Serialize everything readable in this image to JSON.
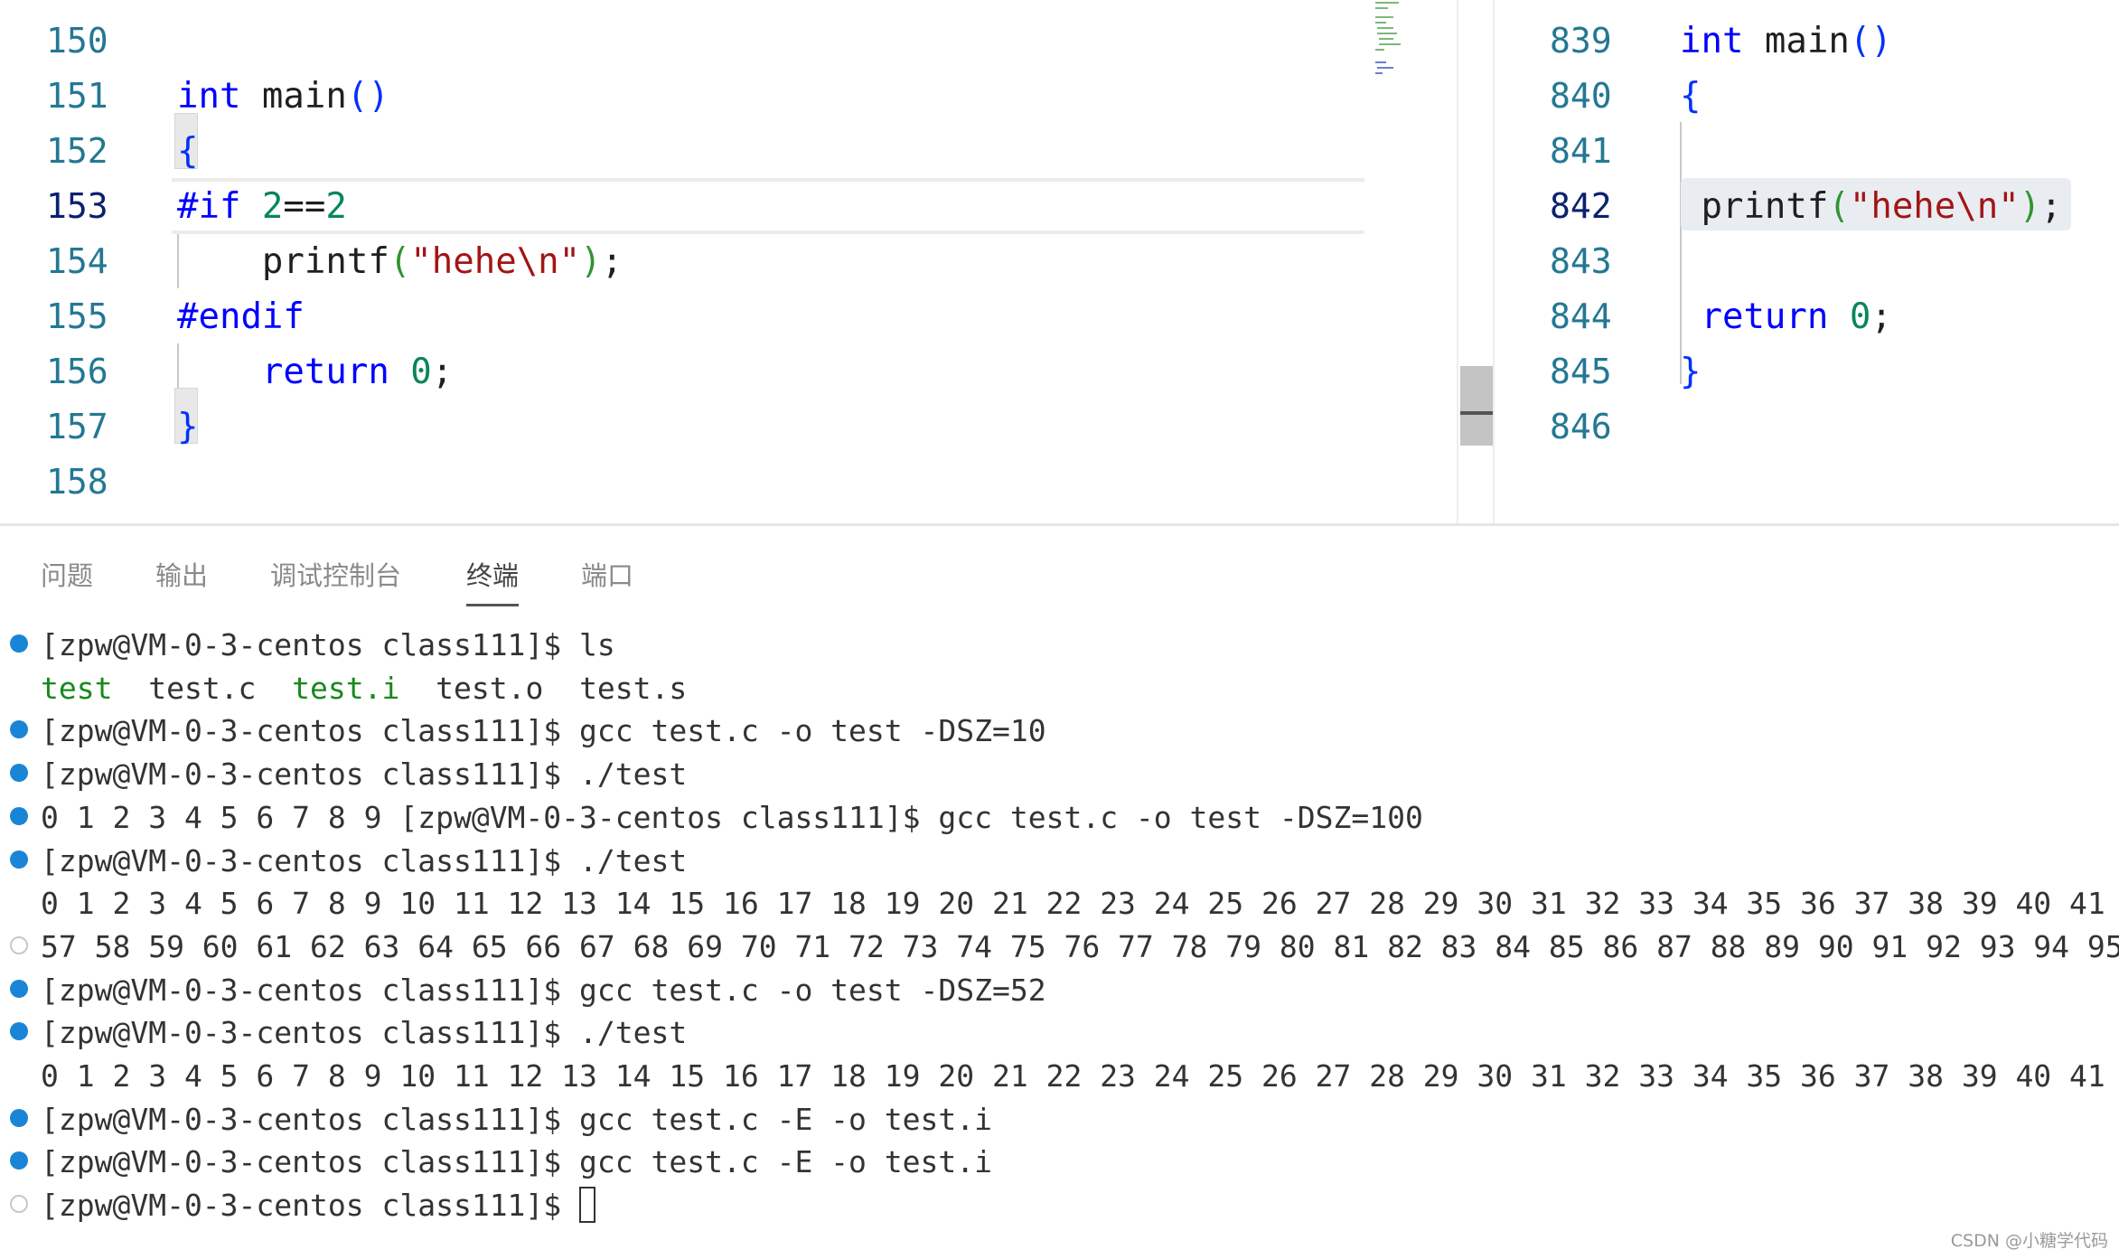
{
  "colors": {
    "keyword": "#0000ff",
    "string": "#a31515",
    "number": "#098658",
    "line_number": "#237893",
    "terminal_dot": "#1a85d6",
    "ls_executable": "#18891d"
  },
  "left_editor": {
    "lines": [
      {
        "num": "150",
        "tokens": []
      },
      {
        "num": "151",
        "tokens": [
          {
            "t": "int",
            "c": "kw"
          },
          {
            "t": " main",
            "c": "txt"
          },
          {
            "t": "()",
            "c": "br1"
          }
        ]
      },
      {
        "num": "152",
        "tokens": [
          {
            "t": "{",
            "c": "br1"
          }
        ]
      },
      {
        "num": "153",
        "current": true,
        "tokens": [
          {
            "t": "#if ",
            "c": "pp"
          },
          {
            "t": "2",
            "c": "num"
          },
          {
            "t": "==",
            "c": "txt"
          },
          {
            "t": "2",
            "c": "num"
          }
        ]
      },
      {
        "num": "154",
        "tokens": [
          {
            "t": "    printf",
            "c": "txt"
          },
          {
            "t": "(",
            "c": "br2"
          },
          {
            "t": "\"hehe\\n\"",
            "c": "str"
          },
          {
            "t": ")",
            "c": "br2"
          },
          {
            "t": ";",
            "c": "txt"
          }
        ]
      },
      {
        "num": "155",
        "tokens": [
          {
            "t": "#endif",
            "c": "pp"
          }
        ]
      },
      {
        "num": "156",
        "tokens": [
          {
            "t": "    return ",
            "c": "kw"
          },
          {
            "t": "0",
            "c": "num"
          },
          {
            "t": ";",
            "c": "txt"
          }
        ]
      },
      {
        "num": "157",
        "tokens": [
          {
            "t": "}",
            "c": "br1"
          }
        ]
      },
      {
        "num": "158",
        "tokens": []
      }
    ]
  },
  "right_editor": {
    "lines": [
      {
        "num": "839",
        "tokens": [
          {
            "t": "int",
            "c": "kw"
          },
          {
            "t": " main",
            "c": "txt"
          },
          {
            "t": "()",
            "c": "br1"
          }
        ]
      },
      {
        "num": "840",
        "tokens": [
          {
            "t": "{",
            "c": "br1"
          }
        ]
      },
      {
        "num": "841",
        "tokens": []
      },
      {
        "num": "842",
        "current": true,
        "tokens": [
          {
            "t": " printf",
            "c": "txt"
          },
          {
            "t": "(",
            "c": "br2"
          },
          {
            "t": "\"hehe\\n\"",
            "c": "str"
          },
          {
            "t": ")",
            "c": "br2"
          },
          {
            "t": ";",
            "c": "txt"
          }
        ]
      },
      {
        "num": "843",
        "tokens": []
      },
      {
        "num": "844",
        "tokens": [
          {
            "t": " return ",
            "c": "kw"
          },
          {
            "t": "0",
            "c": "num"
          },
          {
            "t": ";",
            "c": "txt"
          }
        ]
      },
      {
        "num": "845",
        "tokens": [
          {
            "t": "}",
            "c": "br1"
          }
        ]
      },
      {
        "num": "846",
        "tokens": []
      }
    ]
  },
  "panel": {
    "tabs": [
      {
        "label": "问题"
      },
      {
        "label": "输出"
      },
      {
        "label": "调试控制台"
      },
      {
        "label": "终端",
        "active": true
      },
      {
        "label": "端口"
      }
    ]
  },
  "terminal": {
    "lines": [
      {
        "dot": "filled",
        "text": "[zpw@VM-0-3-centos class111]$ ls"
      },
      {
        "dot": "none",
        "ls": [
          {
            "t": "test",
            "c": "green"
          },
          {
            "t": "  test.c  ",
            "c": ""
          },
          {
            "t": "test.i",
            "c": "green"
          },
          {
            "t": "  test.o  test.s",
            "c": ""
          }
        ]
      },
      {
        "dot": "filled",
        "text": "[zpw@VM-0-3-centos class111]$ gcc test.c -o test -DSZ=10"
      },
      {
        "dot": "filled",
        "text": "[zpw@VM-0-3-centos class111]$ ./test"
      },
      {
        "dot": "filled",
        "text": "0 1 2 3 4 5 6 7 8 9 [zpw@VM-0-3-centos class111]$ gcc test.c -o test -DSZ=100"
      },
      {
        "dot": "filled",
        "text": "[zpw@VM-0-3-centos class111]$ ./test"
      },
      {
        "dot": "none",
        "text": "0 1 2 3 4 5 6 7 8 9 10 11 12 13 14 15 16 17 18 19 20 21 22 23 24 25 26 27 28 29 30 31 32 33 34 35 36 37 38 39 40 41"
      },
      {
        "dot": "hollow",
        "text": "57 58 59 60 61 62 63 64 65 66 67 68 69 70 71 72 73 74 75 76 77 78 79 80 81 82 83 84 85 86 87 88 89 90 91 92 93 94 95"
      },
      {
        "dot": "filled",
        "text": "[zpw@VM-0-3-centos class111]$ gcc test.c -o test -DSZ=52"
      },
      {
        "dot": "filled",
        "text": "[zpw@VM-0-3-centos class111]$ ./test"
      },
      {
        "dot": "none",
        "text": "0 1 2 3 4 5 6 7 8 9 10 11 12 13 14 15 16 17 18 19 20 21 22 23 24 25 26 27 28 29 30 31 32 33 34 35 36 37 38 39 40 41"
      },
      {
        "dot": "filled",
        "text": "[zpw@VM-0-3-centos class111]$ gcc test.c -E -o test.i"
      },
      {
        "dot": "filled",
        "text": "[zpw@VM-0-3-centos class111]$ gcc test.c -E -o test.i"
      },
      {
        "dot": "hollow",
        "text": "[zpw@VM-0-3-centos class111]$ ",
        "cursor": true
      }
    ]
  },
  "watermark": "CSDN @小糖学代码"
}
